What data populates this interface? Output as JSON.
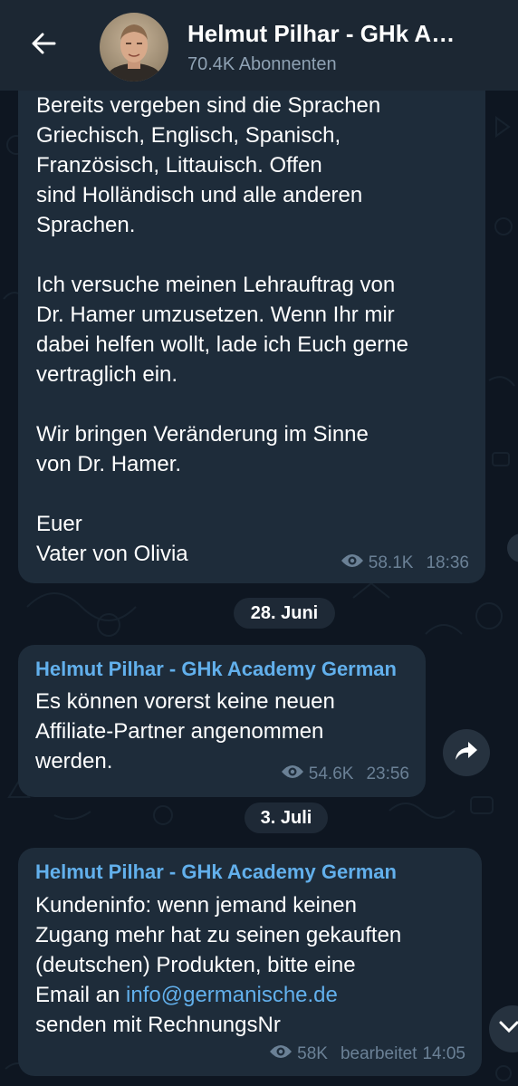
{
  "header": {
    "title": "Helmut Pilhar - GHk A…",
    "subtitle": "70.4K Abonnenten"
  },
  "messages": [
    {
      "lines": [
        "Bereits vergeben sind die Sprachen",
        "Griechisch, Englisch, Spanisch,",
        "Französisch, Littauisch. Offen",
        "sind Holländisch und alle anderen",
        "Sprachen.",
        "",
        "Ich versuche meinen Lehrauftrag von",
        "Dr. Hamer umzusetzen. Wenn Ihr mir",
        "dabei helfen wollt, lade ich Euch gerne",
        "vertraglich ein.",
        "",
        "Wir bringen Veränderung im Sinne",
        "von Dr. Hamer.",
        "",
        "Euer",
        "Vater von Olivia"
      ],
      "views": "58.1K",
      "time": "18:36"
    },
    {
      "sender": "Helmut Pilhar - GHk Academy German",
      "lines": [
        "Es können vorerst keine neuen",
        "Affiliate-Partner angenommen",
        "werden."
      ],
      "views": "54.6K",
      "time": "23:56"
    },
    {
      "sender": "Helmut Pilhar - GHk Academy German",
      "text_1": "Kundeninfo: wenn jemand keinen",
      "text_2": "Zugang mehr hat zu seinen gekauften",
      "text_3": "(deutschen) Produkten, bitte eine",
      "text_4_prefix": "Email an ",
      "text_4_link": "info@germanische.de",
      "text_5": "senden mit RechnungsNr",
      "views": "58K",
      "edited": "bearbeitet",
      "time": "14:05"
    }
  ],
  "dates": [
    "28. Juni",
    "3. Juli"
  ],
  "colors": {
    "background": "#0e1621",
    "header": "#1c2733",
    "bubble": "#1e2c3a",
    "accent": "#62b0ec",
    "meta": "#6b8196"
  },
  "icons": {
    "back": "arrow-left-icon",
    "views": "eye-icon",
    "share": "share-arrow-icon",
    "scroll": "chevron-down-icon"
  }
}
